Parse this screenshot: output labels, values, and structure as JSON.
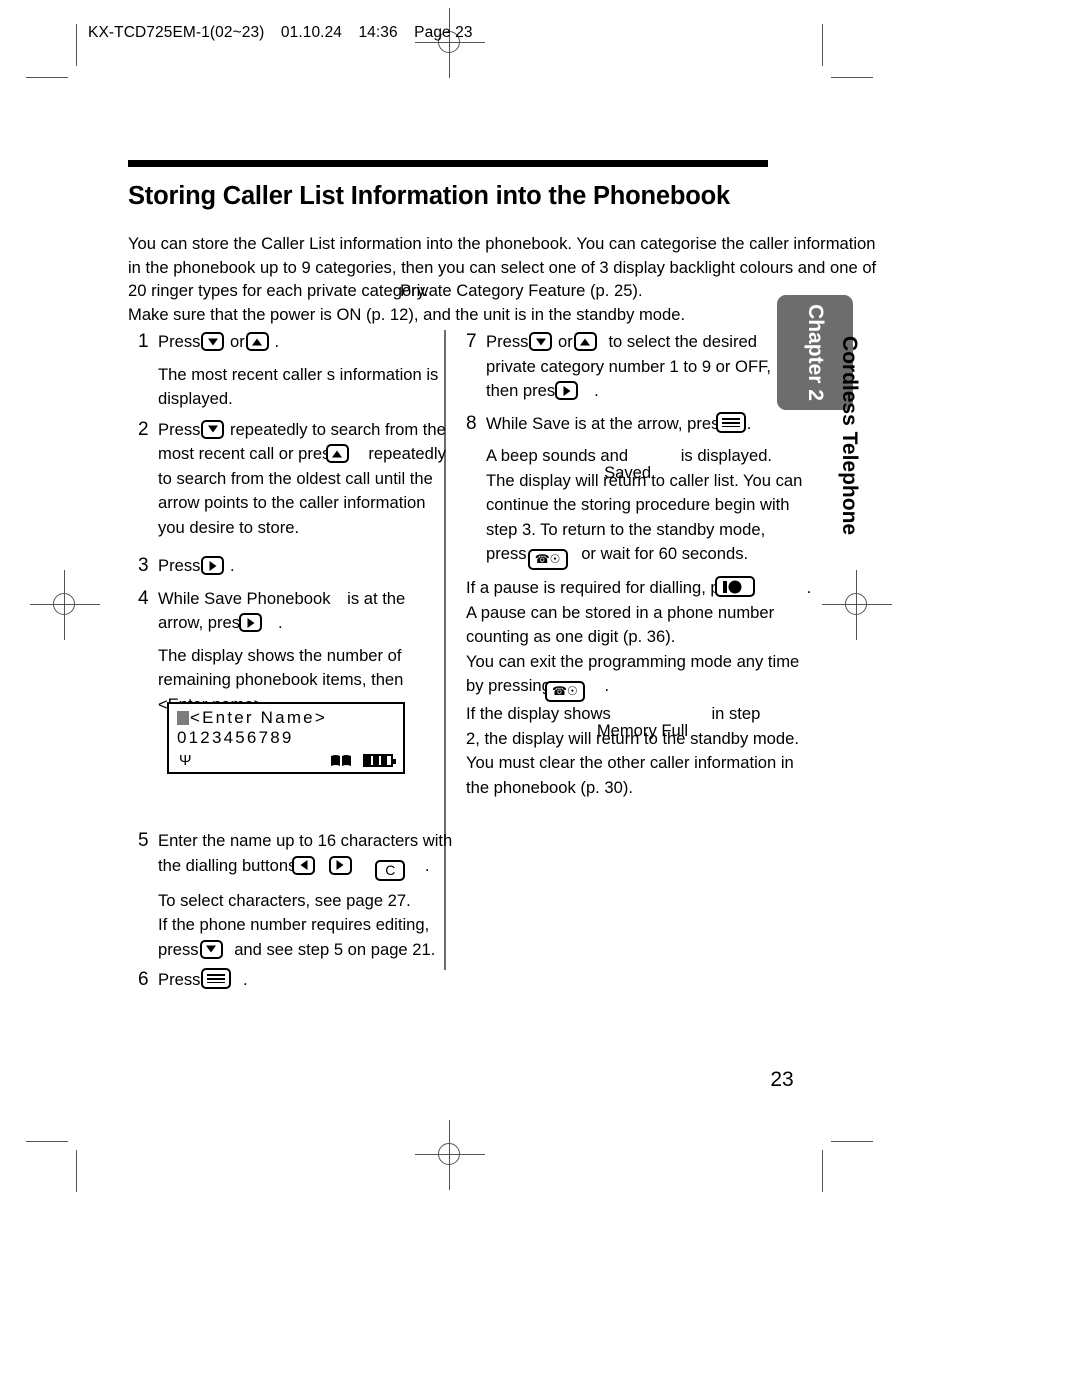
{
  "file_header": {
    "filename": "KX-TCD725EM-1(02~23)",
    "date": "01.10.24",
    "time": "14:36",
    "page_label": "Page 23"
  },
  "page": {
    "title": "Storing Caller List Information into the Phonebook",
    "page_number": "23",
    "chapter_tab": "Chapter 2",
    "side_label": "Cordless Telephone"
  },
  "intro": {
    "line1": "You can store the Caller List information into the phonebook. You can categorise the caller information",
    "line2": "in the phonebook up to 9 categories, then you can select one of 3 display backlight colours and one of",
    "line3": "20 ringer types for each private category.",
    "line3_overlap": "Private Category Feature (p. 25).",
    "line4": "Make sure that the power is ON (p. 12), and the unit is in the standby mode."
  },
  "left_column": {
    "step1": {
      "num": "1",
      "press_label": "Press",
      "or_label": "or",
      "period": ".",
      "detail_line1": "The most recent caller s information is",
      "detail_line2": "displayed."
    },
    "step2": {
      "num": "2",
      "press_label": "Press",
      "text_a": "repeatedly to search from the",
      "text_b": "most recent call or press",
      "text_c": "repeatedly",
      "text_d": "to search from the oldest call until the",
      "text_e": "arrow points to the caller information",
      "text_f": "you desire to store."
    },
    "step3": {
      "num": "3",
      "press_label": "Press",
      "period": "."
    },
    "step4": {
      "num": "4",
      "text_a": "While",
      "text_b": "Save Phonebook",
      "text_c": "is at the",
      "text_d": "arrow, press",
      "period": ".",
      "detail_line1": "The display shows the number of",
      "detail_line2": "remaining phonebook items, then",
      "detail_line3": "<Enter name>",
      "detail_line3_tail": "."
    },
    "lcd": {
      "line1": "<Enter Name>",
      "line2": "0123456789",
      "antenna_icon": "antenna-icon",
      "book_icon": "phonebook-icon",
      "battery_icon": "battery-icon"
    },
    "step5": {
      "num": "5",
      "text_a": "Enter the name up to 16 characters with",
      "text_b": "the dialling buttons,",
      "clear_key_label": "C",
      "period": ".",
      "detail_line1": "To select characters, see page 27.",
      "detail_line2": "If the phone number requires editing,",
      "detail_line3_a": "press",
      "detail_line3_b": "and see step 5 on page 21."
    },
    "step6": {
      "num": "6",
      "press_label": "Press",
      "period": "."
    }
  },
  "right_column": {
    "step7": {
      "num": "7",
      "press_label": "Press",
      "or_label": "or",
      "text_a": "to select the desired",
      "text_b": "private category number 1 to 9 or OFF,",
      "text_c": "then press",
      "period": "."
    },
    "step8": {
      "num": "8",
      "text_a": "While",
      "text_b": "Save",
      "text_c": "is at the arrow, press",
      "period": ".",
      "detail_line1_a": "A beep sounds and",
      "detail_line1_overlap": "Saved",
      "detail_line1_b": "is displayed.",
      "detail_line2": "The display will return to caller list. You can",
      "detail_line3": "continue the storing procedure begin with",
      "detail_line4": "step 3. To return to the standby mode,",
      "detail_line5_a": "press",
      "detail_line5_b": "or wait for 60 seconds."
    },
    "notes": {
      "note1_a": "If a pause is required for dialling, press",
      "note1_b": ".",
      "note2": "A pause can be stored in a phone number",
      "note3": "counting as one digit (p. 36).",
      "note4": "You can exit the programming mode any time",
      "note5_a": "by pressing",
      "note5_b": ".",
      "note6_a": "If the display shows",
      "note6_overlap": "Memory Full",
      "note6_b": "in step",
      "note7": "2, the display will return to the standby mode.",
      "note8": "You must clear the other caller information in",
      "note9": "the phonebook (p. 30)."
    }
  },
  "icons": {
    "down_key": "arrow-down-key-icon",
    "up_key": "arrow-up-key-icon",
    "right_key": "arrow-right-key-icon",
    "left_key": "arrow-left-key-icon",
    "menu_key": "menu-key-icon",
    "phone_off_key": "phone-off-key-icon",
    "pause_key": "pause-key-icon",
    "clear_key": "clear-key-icon"
  },
  "colors": {
    "tab_gray": "#6d6d6d",
    "text_black": "#000000",
    "crop_mark": "#555555",
    "lcd_cursor": "#7c7c7c"
  }
}
